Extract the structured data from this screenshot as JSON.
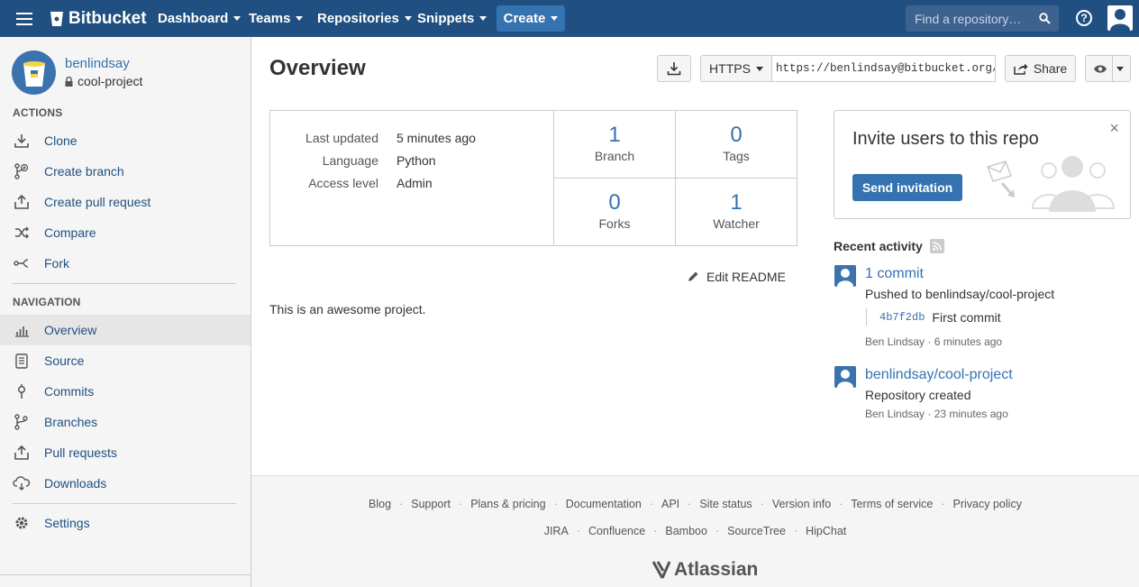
{
  "topbar": {
    "brand": "Bitbucket",
    "nav": [
      "Dashboard",
      "Teams",
      "Repositories",
      "Snippets"
    ],
    "create_label": "Create",
    "search_placeholder": "Find a repository…",
    "help_label": "?"
  },
  "sidebar": {
    "owner": "benlindsay",
    "repo": "cool-project",
    "actions_title": "ACTIONS",
    "actions": [
      {
        "label": "Clone",
        "icon": "download-icon"
      },
      {
        "label": "Create branch",
        "icon": "branch-plus-icon"
      },
      {
        "label": "Create pull request",
        "icon": "pull-request-icon"
      },
      {
        "label": "Compare",
        "icon": "shuffle-icon"
      },
      {
        "label": "Fork",
        "icon": "fork-icon"
      }
    ],
    "navigation_title": "NAVIGATION",
    "navigation": [
      {
        "label": "Overview",
        "icon": "bar-chart-icon",
        "active": true
      },
      {
        "label": "Source",
        "icon": "document-icon"
      },
      {
        "label": "Commits",
        "icon": "commit-icon"
      },
      {
        "label": "Branches",
        "icon": "branch-icon"
      },
      {
        "label": "Pull requests",
        "icon": "pull-request-icon"
      },
      {
        "label": "Downloads",
        "icon": "cloud-download-icon"
      }
    ],
    "settings": {
      "label": "Settings",
      "icon": "gear-icon"
    }
  },
  "main": {
    "title": "Overview",
    "protocol": "HTTPS",
    "clone_url": "https://benlindsay@bitbucket.org/",
    "share_label": "Share",
    "meta": [
      {
        "key": "Last updated",
        "value": "5 minutes ago"
      },
      {
        "key": "Language",
        "value": "Python"
      },
      {
        "key": "Access level",
        "value": "Admin"
      }
    ],
    "stats": [
      {
        "value": "1",
        "label": "Branch"
      },
      {
        "value": "0",
        "label": "Tags"
      },
      {
        "value": "0",
        "label": "Forks"
      },
      {
        "value": "1",
        "label": "Watcher"
      }
    ],
    "edit_readme": "Edit README",
    "readme_text": "This is an awesome project."
  },
  "invite": {
    "title": "Invite users to this repo",
    "button": "Send invitation",
    "close": "×"
  },
  "activity": {
    "title": "Recent activity",
    "items": [
      {
        "link": "1 commit",
        "text": "Pushed to benlindsay/cool-project",
        "commit_hash": "4b7f2db",
        "commit_msg": "First commit",
        "meta": "Ben Lindsay · 6 minutes ago"
      },
      {
        "link": "benlindsay/cool-project",
        "text": "Repository created",
        "meta": "Ben Lindsay · 23 minutes ago"
      }
    ]
  },
  "footer": {
    "row1": [
      "Blog",
      "Support",
      "Plans & pricing",
      "Documentation",
      "API",
      "Site status",
      "Version info",
      "Terms of service",
      "Privacy policy"
    ],
    "row2": [
      "JIRA",
      "Confluence",
      "Bamboo",
      "SourceTree",
      "HipChat"
    ],
    "brand": "Atlassian"
  },
  "colors": {
    "topbar": "#205081",
    "accent": "#3572b0",
    "sidebar_bg": "#f5f5f5"
  }
}
